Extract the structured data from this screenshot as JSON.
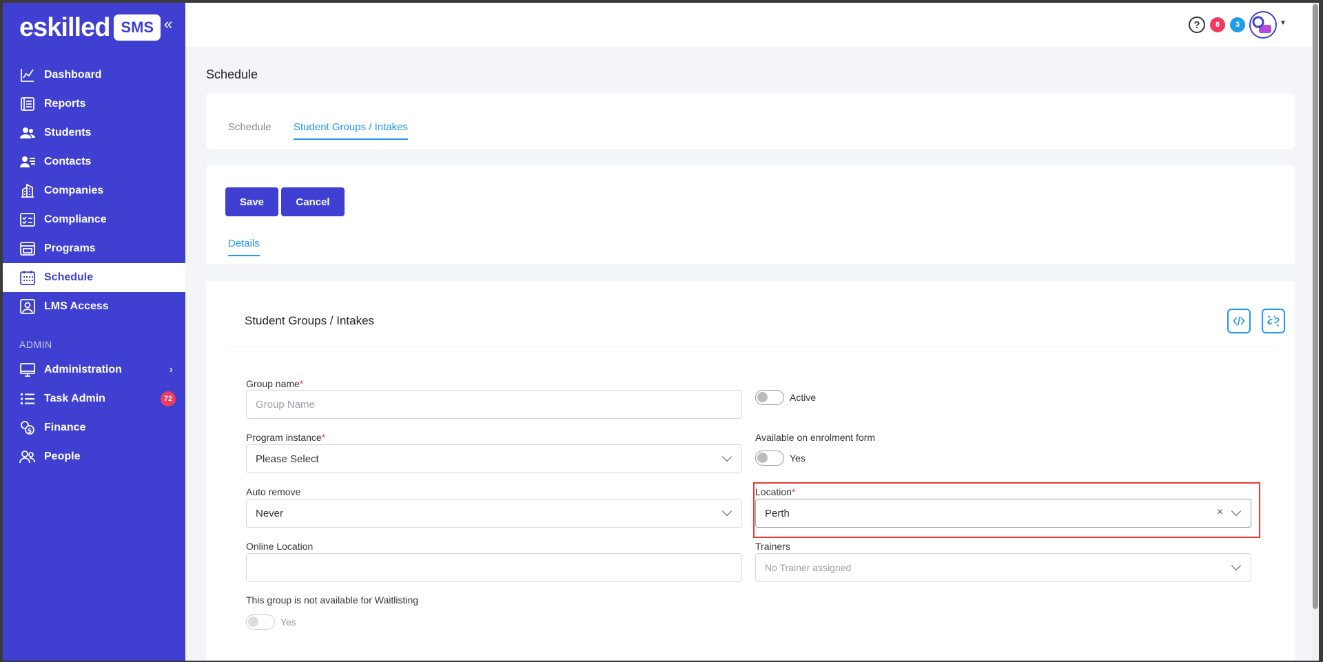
{
  "sidebar": {
    "logo_text": "eskilled",
    "logo_badge": "SMS",
    "collapse_icon": "double-chevron-left-icon",
    "items": [
      {
        "label": "Dashboard",
        "icon": "chart-line-icon"
      },
      {
        "label": "Reports",
        "icon": "report-list-icon"
      },
      {
        "label": "Students",
        "icon": "users-icon"
      },
      {
        "label": "Contacts",
        "icon": "contact-card-icon"
      },
      {
        "label": "Companies",
        "icon": "building-icon"
      },
      {
        "label": "Compliance",
        "icon": "checklist-icon"
      },
      {
        "label": "Programs",
        "icon": "browser-window-icon"
      },
      {
        "label": "Schedule",
        "icon": "calendar-icon",
        "active": true
      },
      {
        "label": "LMS Access",
        "icon": "user-badge-icon"
      }
    ],
    "admin_section": "ADMIN",
    "admin_items": [
      {
        "label": "Administration",
        "icon": "monitor-icon"
      },
      {
        "label": "Task Admin",
        "icon": "task-list-icon",
        "badge": "72"
      },
      {
        "label": "Finance",
        "icon": "coins-icon"
      },
      {
        "label": "People",
        "icon": "people-outline-icon"
      }
    ]
  },
  "topbar": {
    "help_icon": "question-circle-icon",
    "badge_red": "8",
    "badge_blue": "3",
    "avatar_label": "eskilled"
  },
  "page": {
    "title": "Schedule",
    "tabs": [
      "Schedule",
      "Student Groups / Intakes"
    ],
    "save_label": "Save",
    "cancel_label": "Cancel",
    "subtab": "Details"
  },
  "form": {
    "title": "Student Groups / Intakes",
    "group_name_label": "Group name",
    "group_name_placeholder": "Group Name",
    "active_label": "Active",
    "program_instance_label": "Program instance",
    "program_instance_value": "Please Select",
    "enrolment_label": "Available on enrolment form",
    "enrolment_toggle_label": "Yes",
    "auto_remove_label": "Auto remove",
    "auto_remove_value": "Never",
    "location_label": "Location",
    "location_value": "Perth",
    "online_location_label": "Online Location",
    "trainers_label": "Trainers",
    "trainers_placeholder": "No Trainer assigned",
    "waitlist_label": "This group is not available for Waitlisting",
    "waitlist_toggle_label": "Yes",
    "required_mark": "*"
  },
  "colors": {
    "sidebar": "#3f3fd1",
    "accent": "#2196f3",
    "badge_red": "#f03a5f",
    "badge_blue": "#1e9be9",
    "highlight": "#e53935"
  }
}
